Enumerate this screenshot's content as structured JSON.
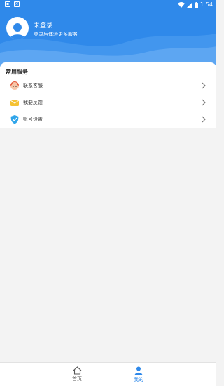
{
  "status_bar": {
    "time": "1:54",
    "left_icons": [
      "notification-icon",
      "app-icon"
    ],
    "right_icons": [
      "wifi-icon",
      "signal-icon",
      "battery-icon"
    ]
  },
  "profile": {
    "name": "未登录",
    "hint": "登录后体验更多服务",
    "avatar_icon": "user-avatar-icon"
  },
  "services": {
    "title": "常用服务",
    "items": [
      {
        "label": "联系客服",
        "icon": "customer-service-icon"
      },
      {
        "label": "我要反馈",
        "icon": "feedback-icon"
      },
      {
        "label": "账号设置",
        "icon": "account-settings-icon"
      }
    ]
  },
  "bottom_nav": {
    "items": [
      {
        "label": "首页",
        "icon": "home-icon",
        "active": false
      },
      {
        "label": "我的",
        "icon": "profile-icon",
        "active": true
      }
    ]
  },
  "colors": {
    "brand": "#2f89ea",
    "active_tab": "#2f89ea",
    "inactive_tab": "#555555",
    "background": "#f3f3f3"
  }
}
